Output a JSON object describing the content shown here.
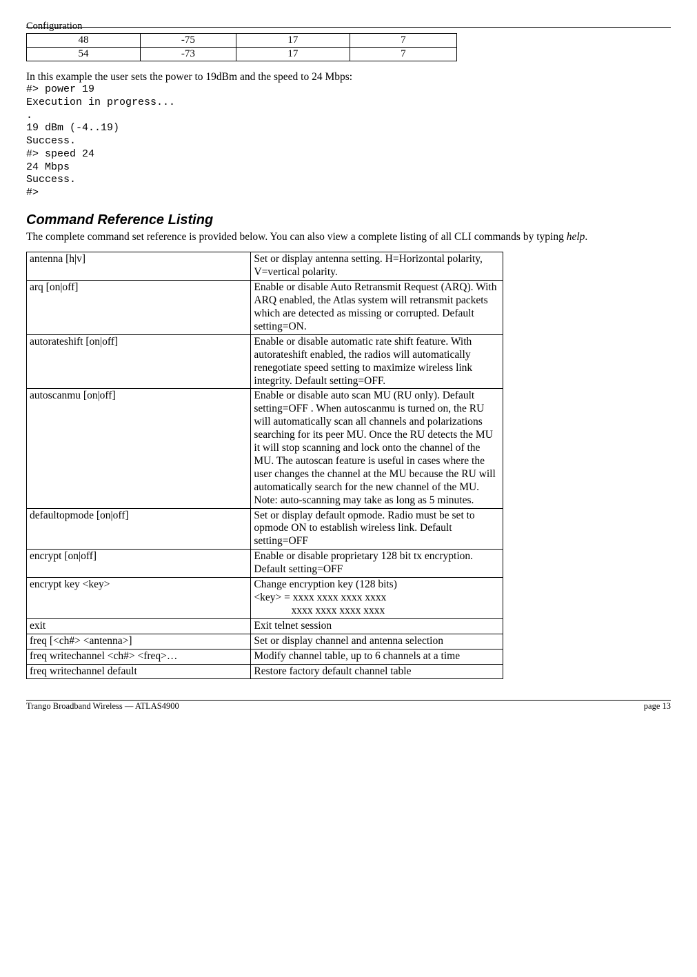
{
  "header": {
    "section": "Configuration"
  },
  "power_table": {
    "rows": [
      [
        "48",
        "-75",
        "17",
        "7"
      ],
      [
        "54",
        "-73",
        "17",
        "7"
      ]
    ]
  },
  "example": {
    "intro": "In this example the user sets the power to 19dBm and the speed to 24 Mbps:",
    "code": "#> power 19\nExecution in progress...\n.\n19 dBm (-4..19)\nSuccess.\n#> speed 24\n24 Mbps\nSuccess.\n#>"
  },
  "section": {
    "title": "Command Reference Listing",
    "desc_pre": "The complete command set reference is provided below.  You can also view a complete listing of all CLI commands by typing ",
    "desc_em": "help",
    "desc_post": "."
  },
  "commands": [
    {
      "cmd": "antenna [h|v]",
      "desc": "Set or display antenna setting.  H=Horizontal polarity, V=vertical polarity."
    },
    {
      "cmd": "arq [on|off]",
      "desc": "Enable or disable Auto Retransmit Request (ARQ).  With ARQ enabled, the Atlas system will retransmit packets which are detected as missing or corrupted.  Default setting=ON."
    },
    {
      "cmd": "autorateshift [on|off]",
      "desc": "Enable or disable automatic rate shift feature.  With autorateshift enabled, the radios will automatically renegotiate speed setting to maximize wireless link integrity.  Default setting=OFF."
    },
    {
      "cmd": "autoscanmu [on|off]",
      "desc": "Enable or disable auto scan MU (RU only).  Default setting=OFF .  When autoscanmu is turned on, the RU will automatically scan all channels and polarizations searching for its peer MU.  Once the RU detects the MU it will stop scanning and lock onto the channel of the MU.  The autoscan feature is useful in cases where the user changes the channel at the MU because the RU will automatically search for the new channel of the MU.  Note:  auto-scanning may take as long as 5 minutes.\n"
    },
    {
      "cmd": "defaultopmode [on|off]",
      "desc": "Set or display default opmode.   Radio must be set to opmode ON to establish wireless link.  Default setting=OFF"
    },
    {
      "cmd": "encrypt [on|off]",
      "desc": "Enable or disable proprietary 128 bit tx encryption.\nDefault setting=OFF"
    },
    {
      "cmd": "encrypt key <key>",
      "desc": "Change encryption key (128 bits)\n<key> = xxxx xxxx xxxx xxxx\n              xxxx xxxx xxxx xxxx"
    },
    {
      "cmd": "exit",
      "desc": "Exit telnet session"
    },
    {
      "cmd": "freq [<ch#> <antenna>]",
      "desc": "Set or display channel and antenna selection"
    },
    {
      "cmd": "freq writechannel <ch#> <freq>…",
      "desc": "Modify channel table, up to 6 channels at a time"
    },
    {
      "cmd": "freq writechannel default",
      "desc": "Restore factory default channel table"
    }
  ],
  "footer": {
    "left": "Trango Broadband Wireless — ATLAS4900",
    "right": "page 13"
  }
}
